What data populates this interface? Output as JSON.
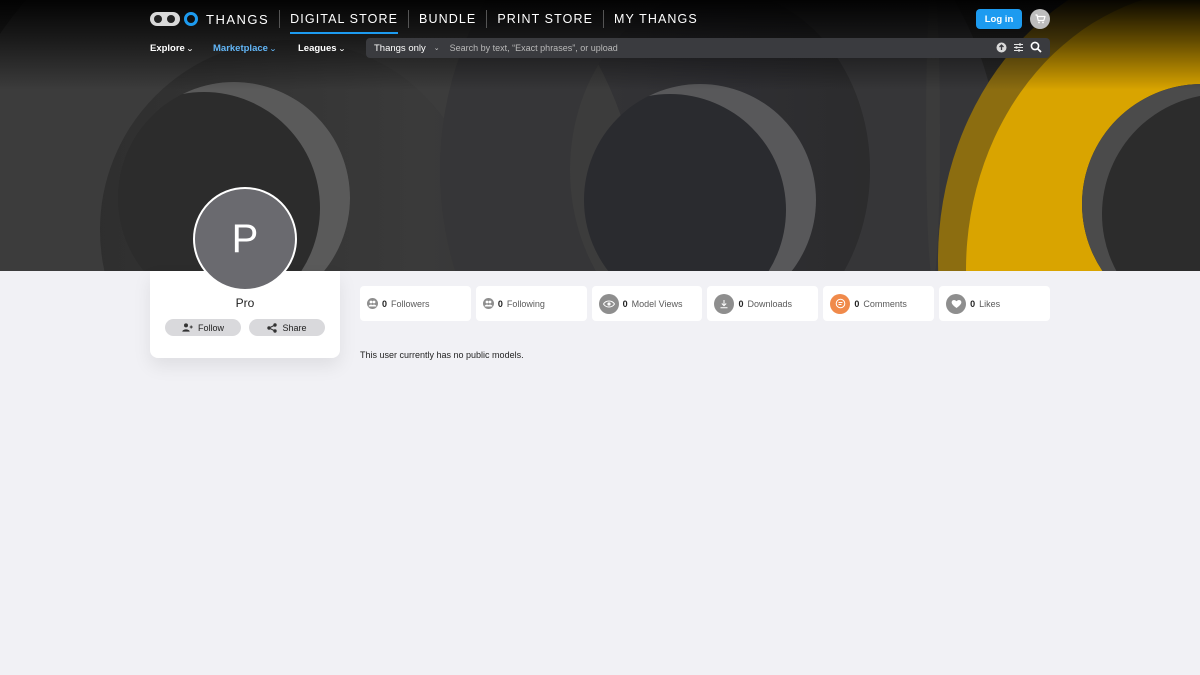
{
  "header": {
    "brand": "THANGS",
    "nav": [
      "DIGITAL STORE",
      "BUNDLE",
      "PRINT STORE",
      "MY THANGS"
    ],
    "active_nav": "DIGITAL STORE",
    "login_label": "Log in"
  },
  "subnav": {
    "items": [
      {
        "label": "Explore",
        "color": "#ffffff"
      },
      {
        "label": "Marketplace",
        "color": "#62b6f7"
      },
      {
        "label": "Leagues",
        "color": "#ffffff"
      }
    ]
  },
  "search": {
    "scope": "Thangs only",
    "placeholder": "Search by text, “Exact phrases”, or upload"
  },
  "profile": {
    "avatar_letter": "P",
    "username": "Pro",
    "follow_label": "Follow",
    "share_label": "Share"
  },
  "stats": [
    {
      "count": "0",
      "label": "Followers",
      "icon": "users-icon"
    },
    {
      "count": "0",
      "label": "Following",
      "icon": "users-icon"
    },
    {
      "count": "0",
      "label": "Model Views",
      "icon": "eye-icon"
    },
    {
      "count": "0",
      "label": "Downloads",
      "icon": "download-icon"
    },
    {
      "count": "0",
      "label": "Comments",
      "icon": "comment-icon"
    },
    {
      "count": "0",
      "label": "Likes",
      "icon": "heart-icon"
    }
  ],
  "empty_message": "This user currently has no public models.",
  "colors": {
    "accent": "#1d9bf0",
    "background": "#f1f1f5",
    "banner_gold": "#d9a400",
    "comment_orange": "#f08a4b"
  }
}
